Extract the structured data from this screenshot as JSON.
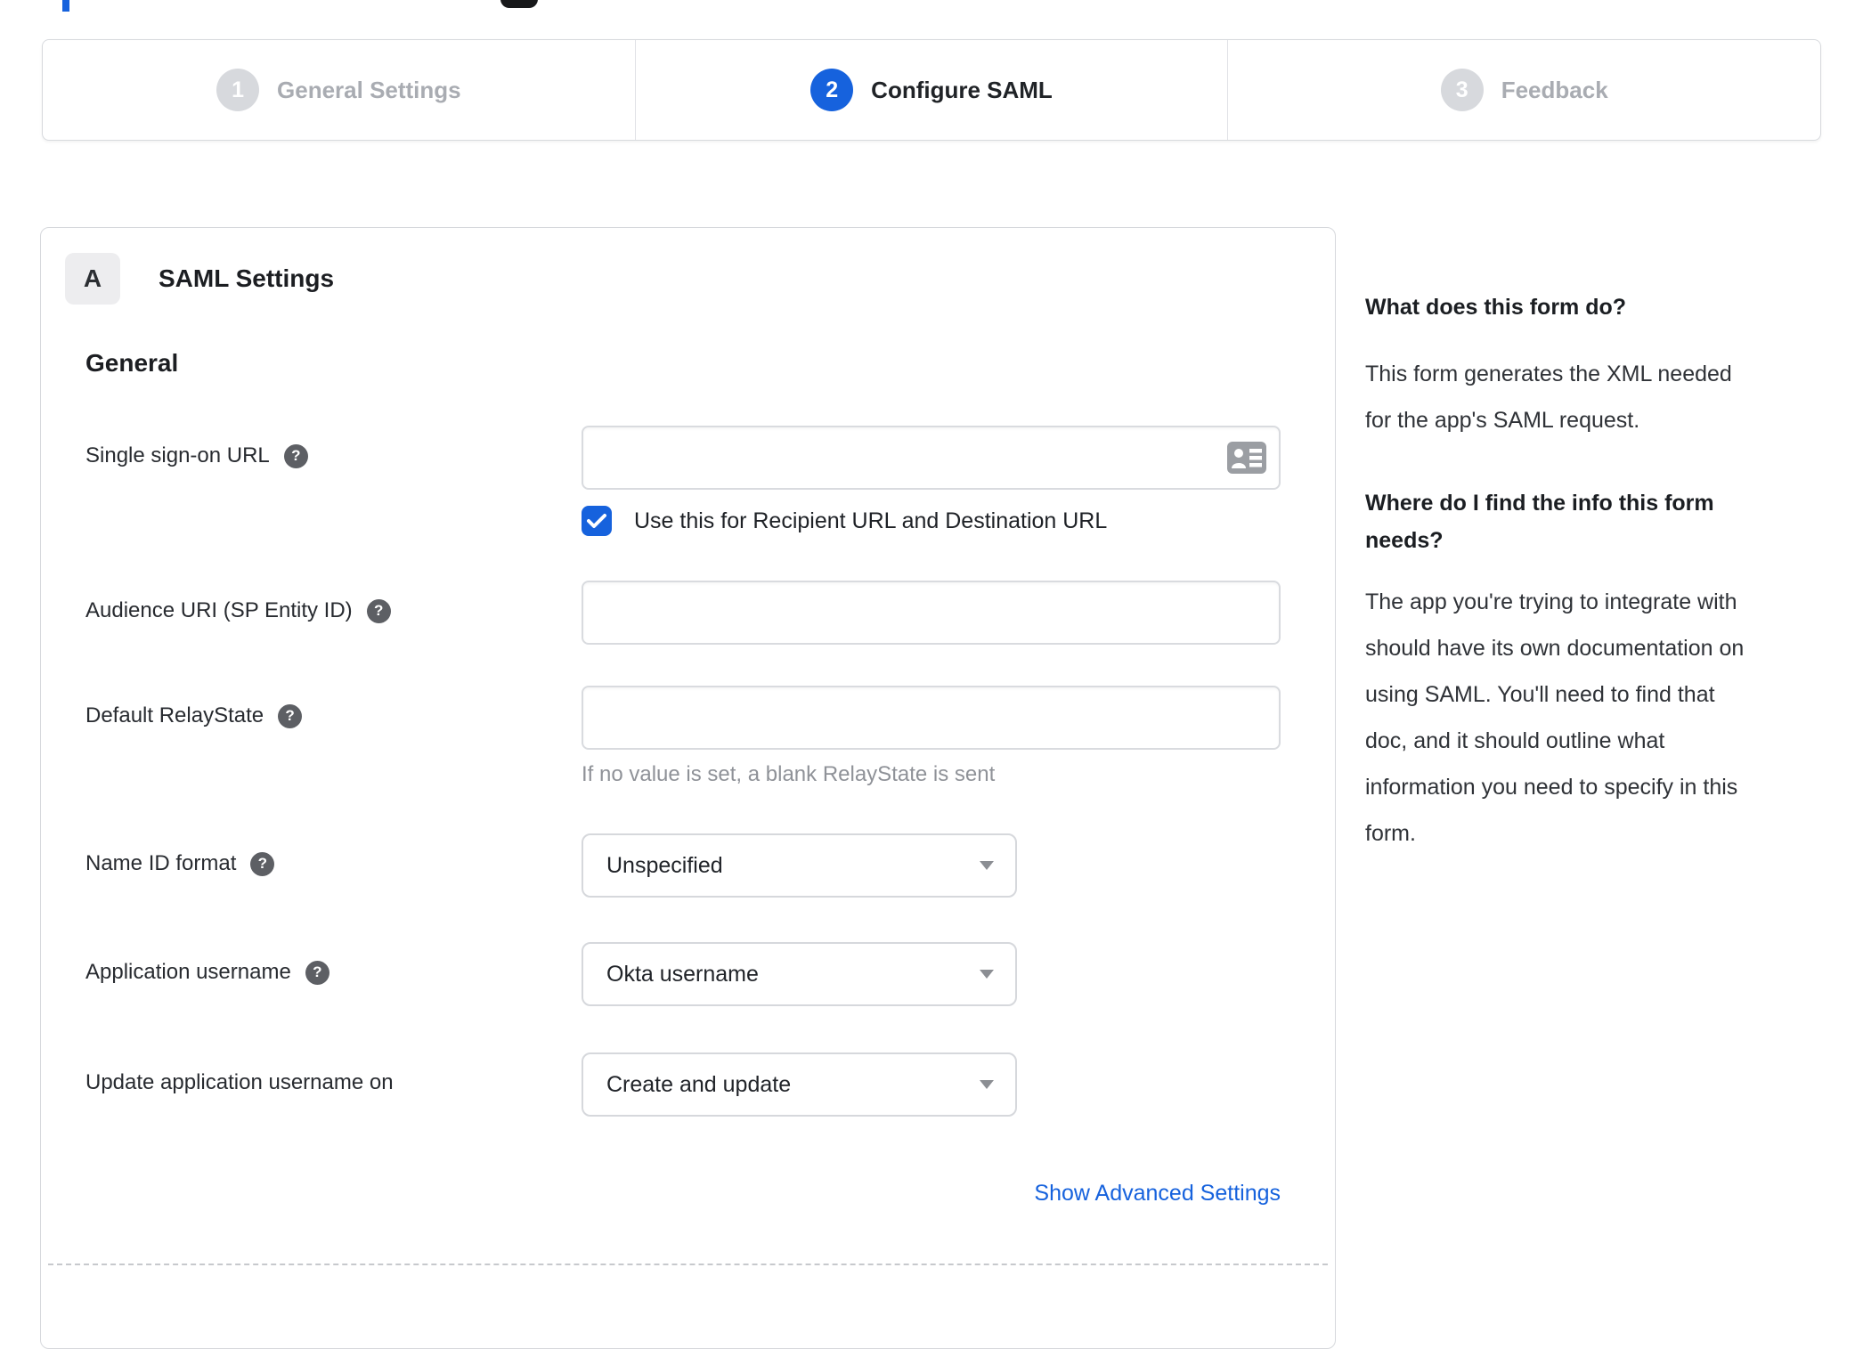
{
  "colors": {
    "accent_blue": "#1662dd",
    "inactive_gray": "#d7d9dd",
    "link_blue": "#1662dd"
  },
  "icons": {
    "help_glyph": "?"
  },
  "stepper": {
    "steps": [
      {
        "number": "1",
        "label": "General Settings",
        "active": false
      },
      {
        "number": "2",
        "label": "Configure SAML",
        "active": true
      },
      {
        "number": "3",
        "label": "Feedback",
        "active": false
      }
    ]
  },
  "panel": {
    "badge": "A",
    "title": "SAML Settings",
    "section": "General",
    "rows": {
      "sso": {
        "label": "Single sign-on URL",
        "value": "",
        "checkbox_label": "Use this for Recipient URL and Destination URL",
        "checkbox_checked": true
      },
      "audience": {
        "label": "Audience URI (SP Entity ID)",
        "value": ""
      },
      "relay": {
        "label": "Default RelayState",
        "value": "",
        "hint": "If no value is set, a blank RelayState is sent"
      },
      "nameid": {
        "label": "Name ID format",
        "value": "Unspecified"
      },
      "appuser": {
        "label": "Application username",
        "value": "Okta username"
      },
      "update": {
        "label": "Update application username on",
        "value": "Create and update"
      }
    },
    "advanced_link": "Show Advanced Settings"
  },
  "sidebar": {
    "q1": "What does this form do?",
    "a1_lines": {
      "0": "This form generates the XML needed",
      "1": "for the app's SAML request."
    },
    "q2_lines": {
      "0": "Where do I find the info this form",
      "1": "needs?"
    },
    "a2_lines": {
      "0": "The app you're trying to integrate with",
      "1": "should have its own documentation on",
      "2": "using SAML. You'll need to find that",
      "3": "doc, and it should outline what",
      "4": "information you need to specify in this",
      "5": "form."
    }
  }
}
